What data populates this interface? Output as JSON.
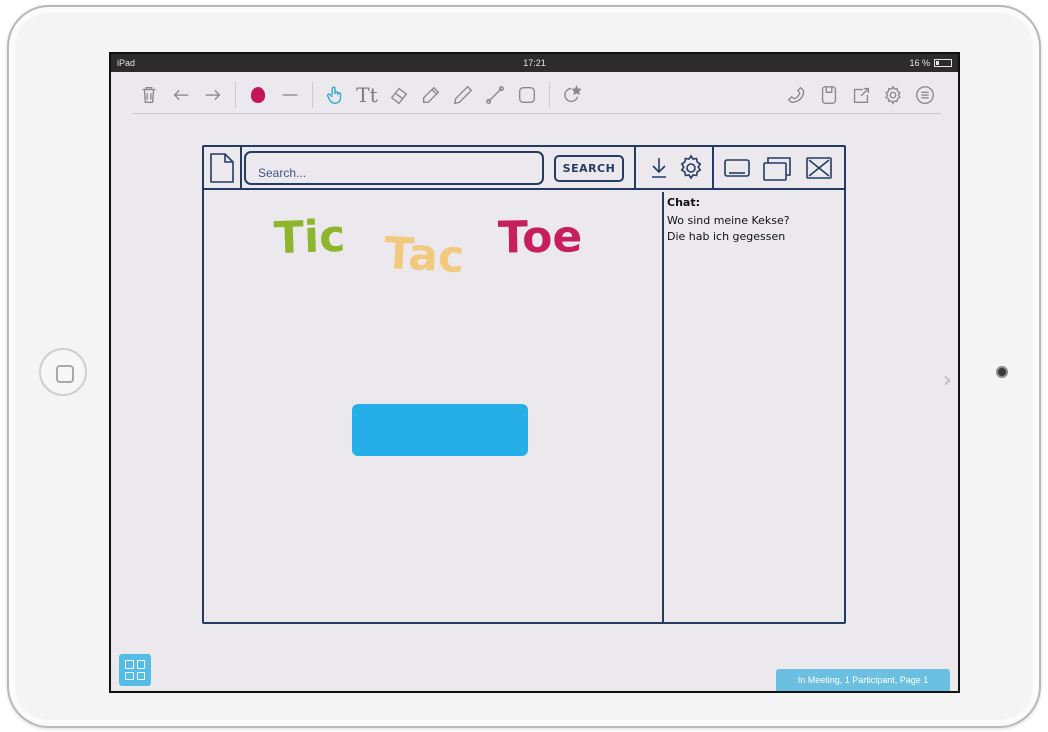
{
  "statusbar": {
    "device": "iPad",
    "time": "17:21",
    "battery": "16 %"
  },
  "toolbar": {
    "tools": [
      "trash-icon",
      "undo-icon",
      "redo-icon",
      "color-icon",
      "line-width-icon",
      "hand-pointer-icon",
      "text-icon",
      "eraser-icon",
      "marker-icon",
      "pen-icon",
      "line-tool-icon",
      "shape-icon",
      "star-stamp-icon",
      "phone-icon",
      "document-icon",
      "share-icon",
      "settings-icon",
      "list-icon"
    ],
    "text_tool_label": "Tt",
    "accent_color": "#2ea9cf",
    "brush_color": "#c7155a"
  },
  "mockup": {
    "search_placeholder": "Search...",
    "search_button": "SEARCH",
    "chat": {
      "label": "Chat:",
      "messages": [
        "Wo sind meine Kekse?",
        "Die hab ich gegessen"
      ]
    },
    "title": {
      "word1": "Tic",
      "word2": "Tac",
      "word3": "Toe"
    },
    "play_button_color": "#26aee8",
    "stroke_color": "#253b62"
  },
  "bottom": {
    "meeting_status": "In Meeting, 1 Participant, Page 1",
    "next_chevron": "›"
  }
}
